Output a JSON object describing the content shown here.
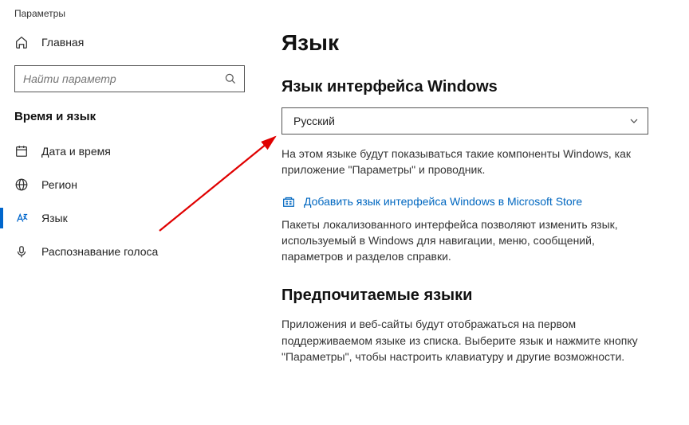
{
  "app_title": "Параметры",
  "home_label": "Главная",
  "search_placeholder": "Найти параметр",
  "section_header": "Время и язык",
  "nav": {
    "items": [
      {
        "label": "Дата и время"
      },
      {
        "label": "Регион"
      },
      {
        "label": "Язык"
      },
      {
        "label": "Распознавание голоса"
      }
    ]
  },
  "main": {
    "title": "Язык",
    "section1_heading": "Язык интерфейса Windows",
    "dropdown_value": "Русский",
    "desc1": "На этом языке будут показываться такие компоненты Windows, как приложение \"Параметры\" и проводник.",
    "store_link": "Добавить язык интерфейса Windows в Microsoft Store",
    "desc2": "Пакеты локализованного интерфейса позволяют изменить язык, используемый в Windows для навигации, меню, сообщений, параметров и разделов справки.",
    "section2_heading": "Предпочитаемые языки",
    "desc3": "Приложения и веб-сайты будут отображаться на первом поддерживаемом языке из списка. Выберите язык и нажмите кнопку \"Параметры\", чтобы настроить клавиатуру и другие возможности."
  }
}
